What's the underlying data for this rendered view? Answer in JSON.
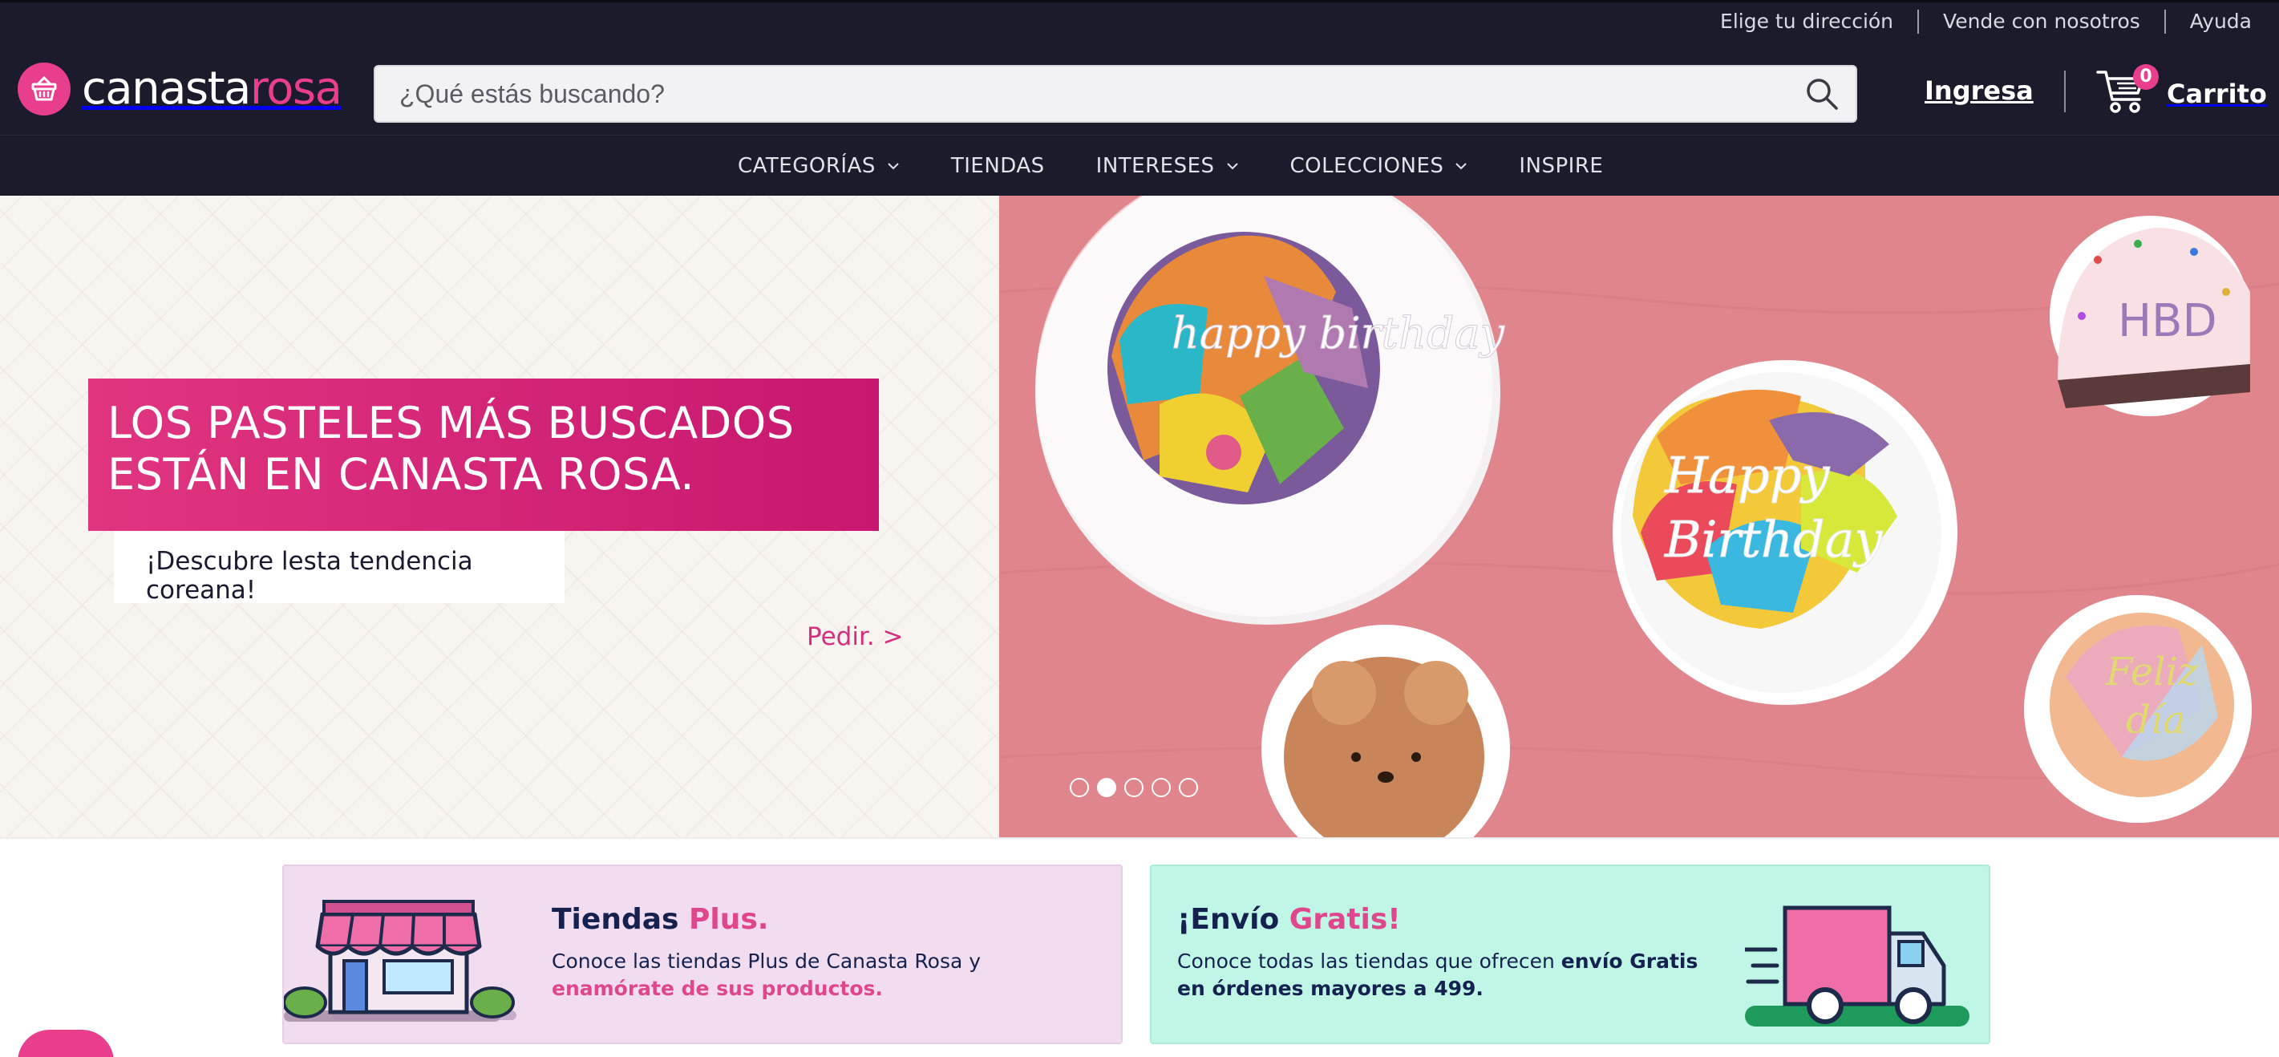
{
  "topbar": {
    "links": [
      "Elige tu dirección",
      "Vende con nosotros",
      "Ayuda"
    ]
  },
  "header": {
    "logo_part1": "canasta",
    "logo_part2": "rosa",
    "search_placeholder": "¿Qué estás buscando?",
    "login_label": "Ingresa",
    "cart_count": "0",
    "cart_label": "Carrito"
  },
  "nav": {
    "items": [
      {
        "label": "CATEGORÍAS",
        "has_dropdown": true
      },
      {
        "label": "TIENDAS",
        "has_dropdown": false
      },
      {
        "label": "INTERESES",
        "has_dropdown": true
      },
      {
        "label": "COLECCIONES",
        "has_dropdown": true
      },
      {
        "label": "INSPIRE",
        "has_dropdown": false
      }
    ]
  },
  "hero": {
    "headline_line1": "LOS PASTELES MÁS BUSCADOS",
    "headline_line2": "ESTÁN EN CANASTA ROSA.",
    "subtitle": "¡Descubre lesta tendencia coreana!",
    "cta": "Pedir. >",
    "slide_count": 5,
    "active_slide": 2,
    "cake_texts": {
      "cake1": "happy birthday",
      "cake2_line1": "Happy",
      "cake2_line2": "Birthday",
      "cake3": "HBD",
      "cake4_line1": "Feliz",
      "cake4_line2": "día"
    }
  },
  "promos": {
    "plus": {
      "title_main": "Tiendas ",
      "title_accent": "Plus.",
      "text_plain": "Conoce las tiendas Plus de Canasta Rosa y ",
      "text_highlight": "enamórate de sus productos."
    },
    "envio": {
      "title_main": "¡Envío ",
      "title_accent": "Gratis!",
      "text_plain": "Conoce todas las tiendas que ofrecen ",
      "text_highlight": "envío Gratis en órdenes mayores a 499."
    }
  },
  "colors": {
    "brand_pink": "#e83e8c",
    "header_bg": "#1b1b2b",
    "plus_card_bg": "#f2dcef",
    "envio_card_bg": "#bff6e6"
  }
}
